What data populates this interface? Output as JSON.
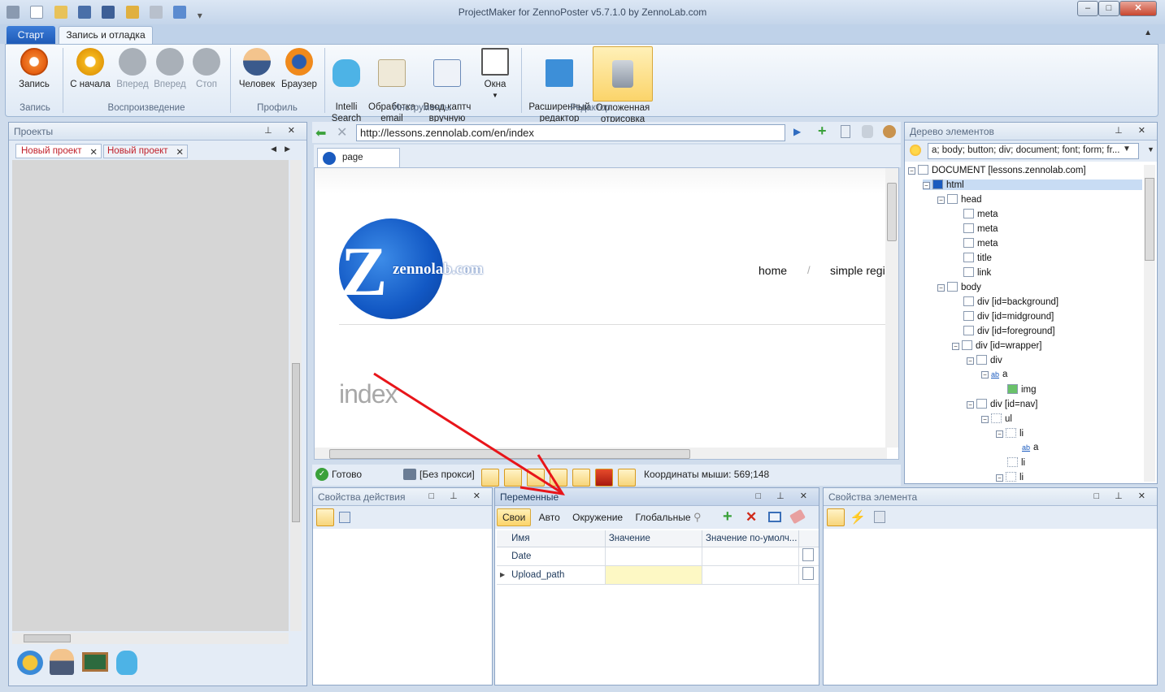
{
  "window": {
    "title": "ProjectMaker for ZennoPoster v5.7.1.0 by ZennoLab.com"
  },
  "ribbon_tabs": {
    "start": "Старт",
    "record": "Запись и отладка"
  },
  "ribbon": {
    "record": "Запись",
    "from_start": "С начала",
    "forward1": "Вперед",
    "forward2": "Вперед",
    "stop": "Стоп",
    "human": "Человек",
    "browser": "Браузер",
    "intelli": "Intelli\nSearch",
    "email": "Обработка\nemail",
    "captcha": "Ввод каптч\nвручную",
    "windows": "Окна",
    "ext_editor": "Расширенный\nредактор",
    "deferred": "Отложенная\nотрисовка",
    "groups": {
      "record": "Запись",
      "playback": "Воспроизведение",
      "profile": "Профиль",
      "tools": "Инструменты",
      "editor": "Редактор"
    }
  },
  "projects": {
    "title": "Проекты",
    "tab1": "Новый проект",
    "tab2": "Новый проект"
  },
  "browser": {
    "url": "http://lessons.zennolab.com/en/index",
    "tab": "page",
    "logo_text": "zennolab.com",
    "nav": {
      "home": "home",
      "sep": "/",
      "simple": "simple regi"
    },
    "heading": "index"
  },
  "status": {
    "ready": "Готово",
    "proxy": "[Без прокси]",
    "coords": "Координаты мыши: 569;148"
  },
  "tree": {
    "title": "Дерево элементов",
    "filter": "a; body; button; div; document; font; form; fr...",
    "nodes": [
      "DOCUMENT [lessons.zennolab.com]",
      "html",
      "head",
      "meta",
      "meta",
      "meta",
      "title",
      "link",
      "body",
      "div [id=background]",
      "div [id=midground]",
      "div [id=foreground]",
      "div [id=wrapper]",
      "div",
      "a",
      "img",
      "div [id=nav]",
      "ul",
      "li",
      "a",
      "li",
      "li"
    ]
  },
  "action_props": {
    "title": "Свойства действия"
  },
  "variables": {
    "title": "Переменные",
    "tabs": [
      "Свои",
      "Авто",
      "Окружение",
      "Глобальные"
    ],
    "columns": [
      "Имя",
      "Значение",
      "Значение по-умолч..."
    ],
    "rows": [
      {
        "name": "Date",
        "value": "",
        "default": ""
      },
      {
        "name": "Upload_path",
        "value": "",
        "default": ""
      }
    ]
  },
  "element_props": {
    "title": "Свойства элемента"
  }
}
